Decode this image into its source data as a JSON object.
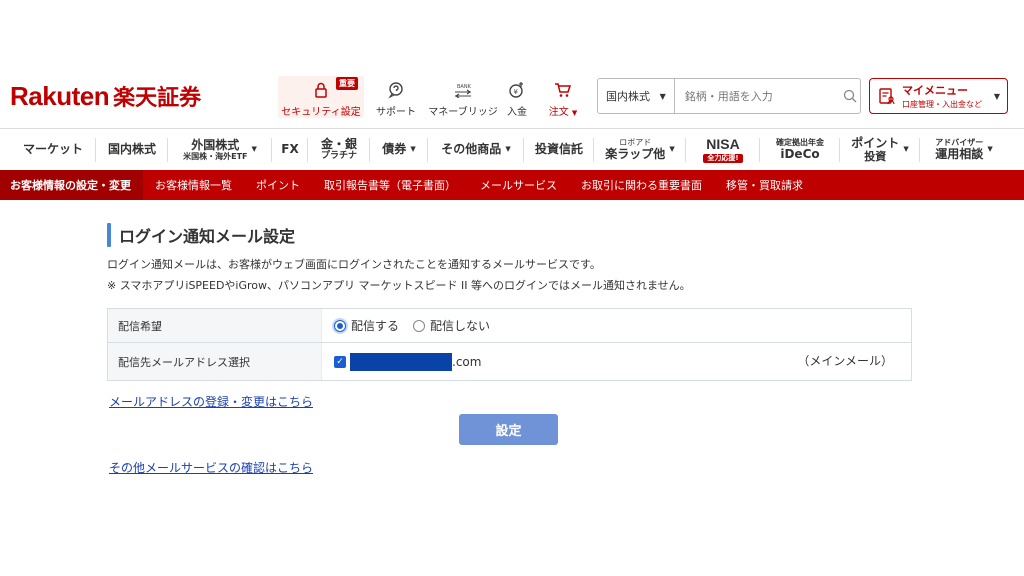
{
  "brand": {
    "logo_en": "Rakuten",
    "logo_jp": "楽天証券",
    "accent_color": "#bf0000"
  },
  "header": {
    "security_label": "セキュリティ設定",
    "security_badge": "重要",
    "support_label": "サポート",
    "bridge_label": "マネーブリッジ",
    "deposit_label": "入金",
    "order_label": "注文",
    "search_category": "国内株式",
    "search_placeholder": "銘柄・用語を入力",
    "mymenu_title": "マイメニュー",
    "mymenu_sub": "口座管理・入出金など"
  },
  "mainnav": {
    "items": [
      {
        "label": "マーケット"
      },
      {
        "label": "国内株式"
      },
      {
        "label": "外国株式",
        "sub": "米国株・海外ETF"
      },
      {
        "label": "FX"
      },
      {
        "label": "金・銀",
        "sub": "プラチナ"
      },
      {
        "label": "債券"
      },
      {
        "label": "その他商品"
      },
      {
        "label": "投資信託"
      },
      {
        "label_small": "ロボアド",
        "label": "楽ラップ他"
      },
      {
        "label": "NISA",
        "tag": "全力応援!"
      },
      {
        "label_small": "確定拠出年金",
        "label": "iDeCo"
      },
      {
        "label": "ポイント",
        "sub": "投資"
      },
      {
        "label_small": "アドバイザー",
        "label": "運用相談"
      }
    ]
  },
  "subnav": {
    "items": [
      "お客様情報の設定・変更",
      "お客様情報一覧",
      "ポイント",
      "取引報告書等（電子書面）",
      "メールサービス",
      "お取引に関わる重要書面",
      "移管・買取請求"
    ]
  },
  "content": {
    "title": "ログイン通知メール設定",
    "desc1": "ログイン通知メールは、お客様がウェブ画面にログインされたことを通知するメールサービスです。",
    "desc2": "※ スマホアプリiSPEEDやiGrow、パソコンアプリ マーケットスピード II 等へのログインではメール通知されません。",
    "row1_label": "配信希望",
    "radio_on": "配信する",
    "radio_off": "配信しない",
    "row2_label": "配信先メールアドレス選択",
    "email_domain": ".com",
    "email_type": "（メインメール）",
    "link_register": "メールアドレスの登録・変更はこちら",
    "submit_label": "設定",
    "link_other": "その他メールサービスの確認はこちら"
  }
}
